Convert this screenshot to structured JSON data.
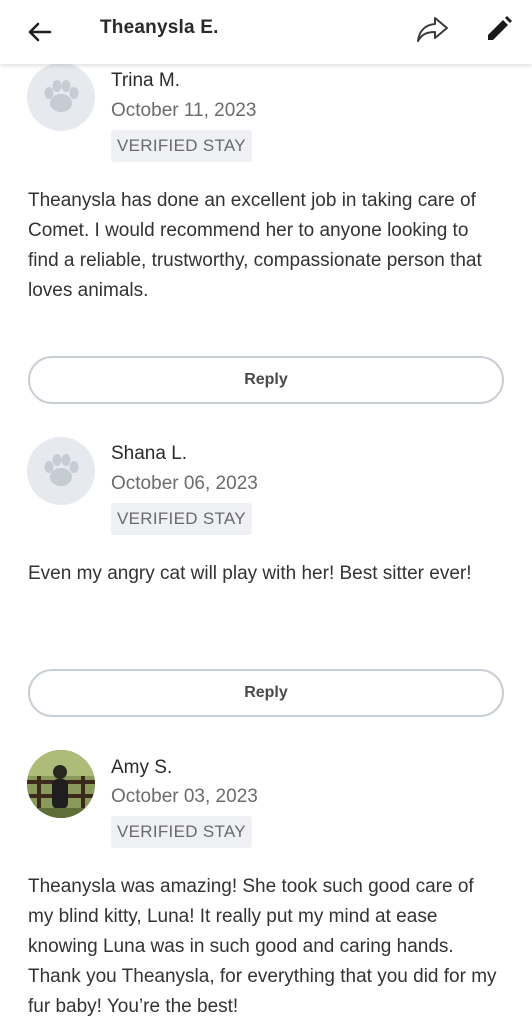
{
  "header": {
    "title": "Theanysla E."
  },
  "reviews": [
    {
      "name": "Trina M.",
      "date": "October 11, 2023",
      "badge": "VERIFIED STAY",
      "text": "Theanysla has done an excellent job in taking care of Comet.  I would recommend her to anyone looking to find a reliable, trustworthy, compassionate person that loves animals.",
      "reply_label": "Reply",
      "avatar": "paw-icon"
    },
    {
      "name": "Shana L.",
      "date": "October 06, 2023",
      "badge": "VERIFIED STAY",
      "text": "Even my angry cat will play with her! Best sitter ever!",
      "reply_label": "Reply",
      "avatar": "paw-icon"
    },
    {
      "name": "Amy S.",
      "date": "October 03, 2023",
      "badge": "VERIFIED STAY",
      "text": "Theanysla was amazing! She took such good care of my blind kitty, Luna! It really put my mind at ease knowing Luna was in such good and caring hands. Thank you Theanysla, for everything that you did for my fur baby! You’re the best!",
      "avatar": "user-photo"
    }
  ]
}
